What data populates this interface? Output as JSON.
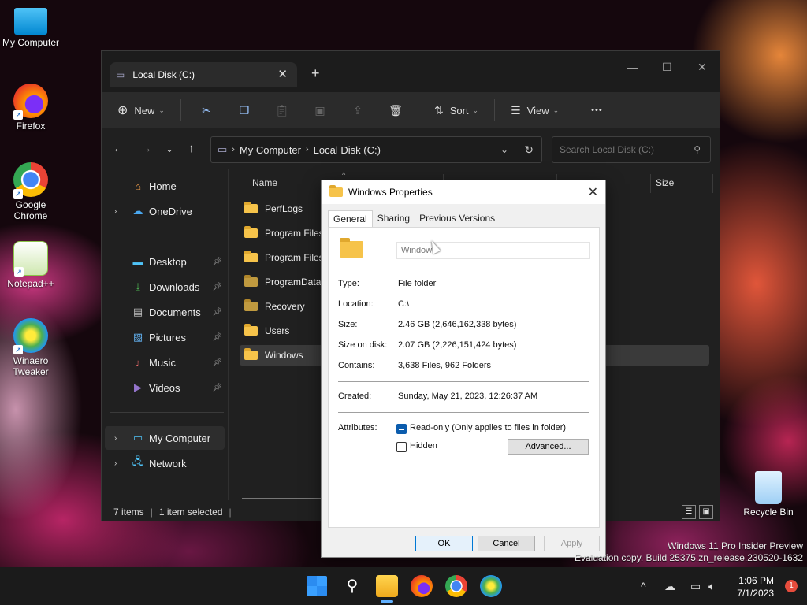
{
  "desktop": {
    "icons": [
      {
        "label": "My Computer",
        "icon": "monitor-icon"
      },
      {
        "label": "Firefox",
        "icon": "firefox-icon"
      },
      {
        "label": "Google Chrome",
        "icon": "chrome-icon"
      },
      {
        "label": "Notepad++",
        "icon": "notepadpp-icon"
      },
      {
        "label": "Winaero Tweaker",
        "icon": "winaero-icon"
      },
      {
        "label": "Recycle Bin",
        "icon": "recycle-bin-icon"
      }
    ],
    "watermark_line1": "Windows 11 Pro Insider Preview",
    "watermark_line2": "Evaluation copy. Build 25375.zn_release.230520-1632"
  },
  "explorer": {
    "tab_title": "Local Disk (C:)",
    "toolbar": {
      "new_label": "New",
      "sort_label": "Sort",
      "view_label": "View",
      "more_label": "•••"
    },
    "breadcrumb": [
      "My Computer",
      "Local Disk (C:)"
    ],
    "search_placeholder": "Search Local Disk (C:)",
    "sidebar": {
      "home": "Home",
      "onedrive": "OneDrive",
      "desktop": "Desktop",
      "downloads": "Downloads",
      "documents": "Documents",
      "pictures": "Pictures",
      "music": "Music",
      "videos": "Videos",
      "my_computer": "My Computer",
      "network": "Network"
    },
    "columns": {
      "name": "Name",
      "size": "Size"
    },
    "files": [
      "PerfLogs",
      "Program Files",
      "Program Files (",
      "ProgramData",
      "Recovery",
      "Users",
      "Windows"
    ],
    "status": {
      "items": "7 items",
      "selected": "1 item selected"
    }
  },
  "dialog": {
    "title": "Windows Properties",
    "tabs": [
      "General",
      "Sharing",
      "Previous Versions"
    ],
    "name_value": "Window",
    "type_label": "Type:",
    "type_value": "File folder",
    "location_label": "Location:",
    "location_value": "C:\\",
    "size_label": "Size:",
    "size_value": "2.46 GB (2,646,162,338 bytes)",
    "size_on_disk_label": "Size on disk:",
    "size_on_disk_value": "2.07 GB (2,226,151,424 bytes)",
    "contains_label": "Contains:",
    "contains_value": "3,638 Files, 962 Folders",
    "created_label": "Created:",
    "created_value": "Sunday, May 21, 2023, 12:26:37 AM",
    "attributes_label": "Attributes:",
    "readonly_label": "Read-only (Only applies to files in folder)",
    "hidden_label": "Hidden",
    "advanced_label": "Advanced...",
    "ok_label": "OK",
    "cancel_label": "Cancel",
    "apply_label": "Apply"
  },
  "taskbar": {
    "time": "1:06 PM",
    "date": "7/1/2023",
    "notification_count": "1"
  }
}
